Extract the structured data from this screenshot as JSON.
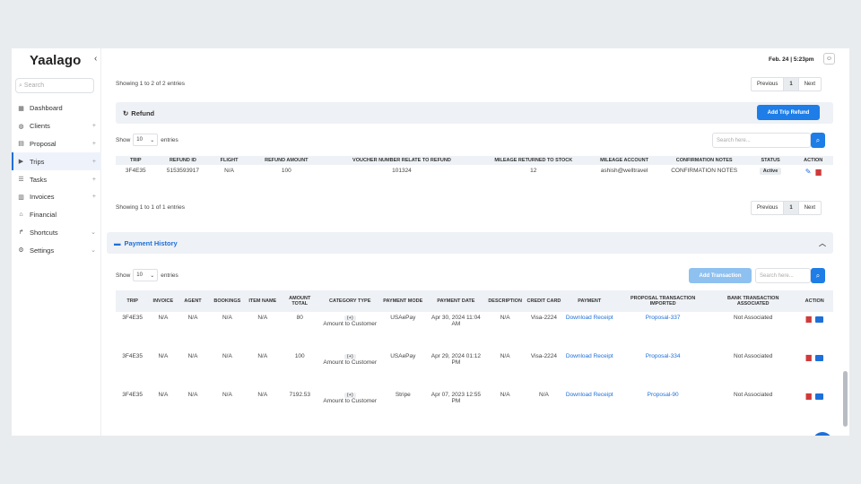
{
  "app": {
    "logo": "Yaalago",
    "collapse_icon": "chevron-left-icon",
    "datetime": "Feb. 24 | 5:23pm"
  },
  "sidebar": {
    "search_placeholder": "Search",
    "items": [
      {
        "label": "Dashboard",
        "icon": "grid-icon",
        "plus": ""
      },
      {
        "label": "Clients",
        "icon": "globe-icon",
        "plus": "+"
      },
      {
        "label": "Proposal",
        "icon": "doc-icon",
        "plus": "+"
      },
      {
        "label": "Trips",
        "icon": "play-icon",
        "plus": "+"
      },
      {
        "label": "Tasks",
        "icon": "task-icon",
        "plus": "+"
      },
      {
        "label": "Invoices",
        "icon": "invoice-icon",
        "plus": "+"
      },
      {
        "label": "Financial",
        "icon": "bank-icon",
        "plus": ""
      },
      {
        "label": "Shortcuts",
        "icon": "share-icon",
        "plus": "⌄"
      },
      {
        "label": "Settings",
        "icon": "gear-icon",
        "plus": "⌄"
      }
    ]
  },
  "top_pager": {
    "info": "Showing 1 to 2 of 2 entries",
    "prev": "Previous",
    "page": "1",
    "next": "Next"
  },
  "refund": {
    "title": "Refund",
    "add_button": "Add Trip Refund",
    "show_label": "Show",
    "show_value": "10",
    "entries_label": "entries",
    "search_placeholder": "Search here...",
    "headers": [
      "TRIP",
      "REFUND ID",
      "FLIGHT",
      "REFUND AMOUNT",
      "VOUCHER NUMBER RELATE TO REFUND",
      "MILEAGE RETURNED TO STOCK",
      "MILEAGE ACCOUNT",
      "CONFIRMATION NOTES",
      "STATUS",
      "ACTION"
    ],
    "rows": [
      {
        "trip": "3F4E35",
        "refund_id": "5153593917",
        "flight": "N/A",
        "amount": "100",
        "voucher": "101324",
        "mileage": "12",
        "account": "ashish@welltravel",
        "notes": "CONFIRMATION NOTES",
        "status": "Active"
      }
    ],
    "info": "Showing 1 to 1 of 1 entries",
    "prev": "Previous",
    "page": "1",
    "next": "Next"
  },
  "payment": {
    "title": "Payment History",
    "add_button": "Add Transaction",
    "show_label": "Show",
    "show_value": "10",
    "entries_label": "entries",
    "search_placeholder": "Search here...",
    "headers": [
      "TRIP",
      "INVOICE",
      "AGENT",
      "BOOKINGS",
      "ITEM NAME",
      "AMOUNT TOTAL",
      "CATEGORY TYPE",
      "PAYMENT MODE",
      "PAYMENT DATE",
      "DESCRIPTION",
      "CREDIT CARD",
      "PAYMENT",
      "PROPOSAL TRANSACTION IMPORTED",
      "BANK TRANSACTION ASSOCIATED",
      "ACTION"
    ],
    "rows": [
      {
        "trip": "3F4E35",
        "invoice": "N/A",
        "agent": "N/A",
        "bookings": "N/A",
        "item": "N/A",
        "amount": "80",
        "cat_sign": "(+)",
        "cat_text": "Amount to Customer",
        "mode": "USAePay",
        "date": "Apr 30, 2024 11:04 AM",
        "desc": "N/A",
        "card": "Visa-2224",
        "payment": "Download Receipt",
        "proposal": "Proposal-337",
        "bank": "Not Associated"
      },
      {
        "trip": "3F4E35",
        "invoice": "N/A",
        "agent": "N/A",
        "bookings": "N/A",
        "item": "N/A",
        "amount": "100",
        "cat_sign": "(+)",
        "cat_text": "Amount to Customer",
        "mode": "USAePay",
        "date": "Apr 29, 2024 01:12 PM",
        "desc": "N/A",
        "card": "Visa-2224",
        "payment": "Download Receipt",
        "proposal": "Proposal-334",
        "bank": "Not Associated"
      },
      {
        "trip": "3F4E35",
        "invoice": "N/A",
        "agent": "N/A",
        "bookings": "N/A",
        "item": "N/A",
        "amount": "7192.53",
        "cat_sign": "(+)",
        "cat_text": "Amount to Customer",
        "mode": "Stripe",
        "date": "Apr 07, 2023 12:55 PM",
        "desc": "N/A",
        "card": "N/A",
        "payment": "Download Receipt",
        "proposal": "Proposal-90",
        "bank": "Not Associated"
      }
    ]
  },
  "colors": {
    "accent": "#1e6fd9",
    "danger": "#d03a3a",
    "header_bg": "#eef1f5"
  }
}
